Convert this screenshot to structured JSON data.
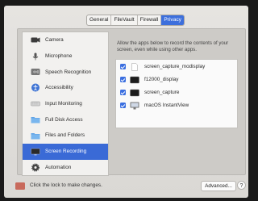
{
  "tabs": [
    {
      "label": "General",
      "active": false
    },
    {
      "label": "FileVault",
      "active": false
    },
    {
      "label": "Firewall",
      "active": false
    },
    {
      "label": "Privacy",
      "active": true
    }
  ],
  "sidebar": {
    "items": [
      {
        "label": "Camera",
        "icon": "camera-icon"
      },
      {
        "label": "Microphone",
        "icon": "microphone-icon"
      },
      {
        "label": "Speech Recognition",
        "icon": "speech-recognition-icon"
      },
      {
        "label": "Accessibility",
        "icon": "accessibility-icon"
      },
      {
        "label": "Input Monitoring",
        "icon": "keyboard-icon"
      },
      {
        "label": "Full Disk Access",
        "icon": "folder-icon"
      },
      {
        "label": "Files and Folders",
        "icon": "folder-icon"
      },
      {
        "label": "Screen Recording",
        "icon": "screen-icon",
        "selected": true
      },
      {
        "label": "Automation",
        "icon": "gear-icon"
      }
    ]
  },
  "main": {
    "description": "Allow the apps below to record the contents of your screen, even while using other apps.",
    "apps": [
      {
        "label": "screen_capture_modisplay",
        "checked": true,
        "icon": "document-icon"
      },
      {
        "label": "f12000_display",
        "checked": true,
        "icon": "terminal-icon"
      },
      {
        "label": "screen_capture",
        "checked": true,
        "icon": "terminal-icon"
      },
      {
        "label": "macOS InstantView",
        "checked": true,
        "icon": "display-icon"
      }
    ]
  },
  "footer": {
    "lock_text": "Click the lock to make changes.",
    "advanced_label": "Advanced...",
    "help_label": "?"
  },
  "colors": {
    "accent": "#3b6fe0",
    "selected_row": "#3a6ad6"
  }
}
